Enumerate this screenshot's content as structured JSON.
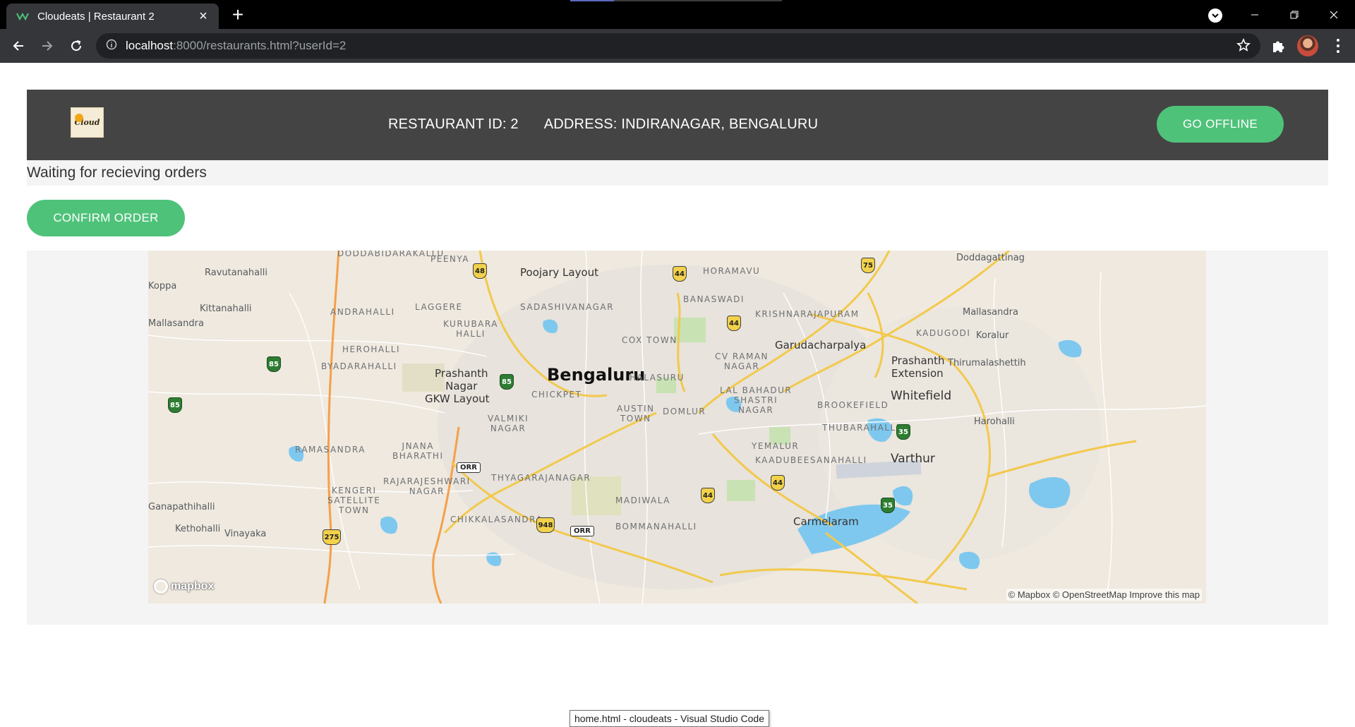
{
  "browser": {
    "tab_title": "Cloudeats | Restaurant 2",
    "url_host": "localhost",
    "url_rest": ":8000/restaurants.html?userId=2"
  },
  "header": {
    "logo_text": "Cloud",
    "restaurant_id": "RESTAURANT ID: 2",
    "address": "ADDRESS: INDIRANAGAR, BENGALURU",
    "go_offline": "GO OFFLINE"
  },
  "status": {
    "text": "Waiting for recieving orders"
  },
  "actions": {
    "confirm_order": "CONFIRM ORDER"
  },
  "map": {
    "labels": {
      "doddabidarakallu": "DODDABIDARAKALLU",
      "peenya": "PEENYA",
      "poojary_layout": "Poojary Layout",
      "horamavu": "HORAMAVU",
      "doddagattinag": "Doddagattinag",
      "ravutanahalli": "Ravutanahalli",
      "koppa": "Koppa",
      "kittanahalli": "Kittanahalli",
      "mallasandra_w": "Mallasandra",
      "laggere": "LAGGERE",
      "sadashivanagar": "SADASHIVANAGAR",
      "banaswadi": "BANASWADI",
      "krishnarajapuram": "KRISHNARAJAPURAM",
      "mallasandra_e": "Mallasandra",
      "andrahalli": "ANDRAHALLI",
      "kurubara_halli": "KURUBARA\nHALLI",
      "kadugodi": "KADUGODI",
      "koralur": "Koralur",
      "cox_town": "COX TOWN",
      "garudacharpalya": "Garudacharpalya",
      "herohalli": "HEROHALLI",
      "cv_raman_nagar": "CV RAMAN\nNAGAR",
      "prashanth_extension": "Prashanth\nExtension",
      "thirumalashettih": "Thirumalashettih",
      "byadarahalli": "BYADARAHALLI",
      "prashanth_nagar": "Prashanth\nNagar",
      "bengaluru": "Bengaluru",
      "halasuru": "HALASURU",
      "gkw_layout": "GKW Layout",
      "chickpet": "CHICKPET",
      "lal_bahadur": "LAL BAHADUR\nSHASTRI\nNAGAR",
      "whitefield": "Whitefield",
      "brookefield": "BROOKEFIELD",
      "austin_town": "AUSTIN\nTOWN",
      "domlur": "DOMLUR",
      "valmiki_nagar": "VALMIKI\nNAGAR",
      "harohalli": "Harohalli",
      "thubarahalli": "THUBARAHALLI",
      "ramasandra": "RAMASANDRA",
      "jnana_bharathi": "JNANA\nBHARATHI",
      "yemalur": "YEMALUR",
      "varthur": "Varthur",
      "kaadubeesanahalli": "KAADUBEESANAHALLI",
      "thyagarajanagar": "THYAGARAJANAGAR",
      "rajarajeshwari": "RAJARAJESHWARI\nNAGAR",
      "kengeri": "KENGERI\nSATELLITE\nTOWN",
      "madiwala": "MADIWALA",
      "ganapathihalli": "Ganapathihalli",
      "kethohalli": "Kethohalli",
      "vinayaka": "Vinayaka",
      "chikkalasandra": "CHIKKALASANDRA",
      "bommanahalli": "BOMMANAHALLI",
      "carmelaram": "Carmelaram"
    },
    "shields": [
      "48",
      "44",
      "75",
      "44",
      "85",
      "85",
      "85",
      "35",
      "44",
      "44",
      "35",
      "948",
      "275"
    ],
    "orr": "ORR",
    "logo": "mapbox",
    "attribution": "© Mapbox © OpenStreetMap Improve this map"
  },
  "tooltip": "home.html - cloudeats - Visual Studio Code",
  "colors": {
    "accent_green": "#4fc27a",
    "header_bg": "#444444",
    "map_water": "#7ec8ef",
    "map_road_major": "#f2c94c",
    "map_road_arterial": "#f5a04a"
  }
}
